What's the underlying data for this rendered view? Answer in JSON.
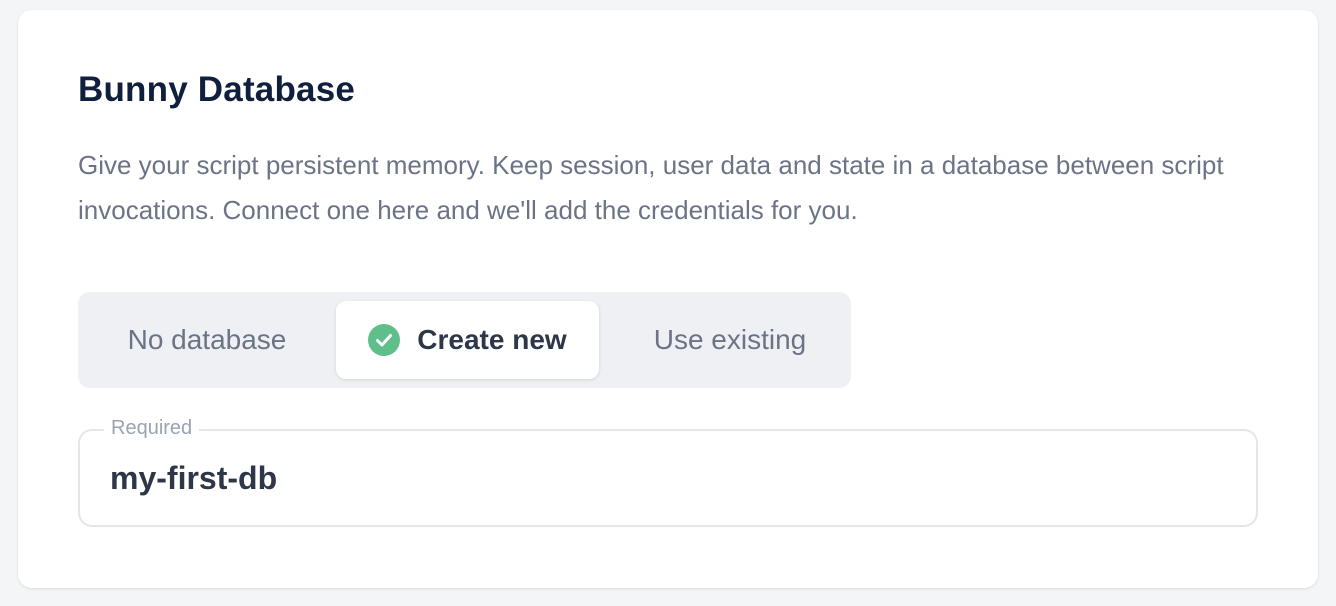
{
  "card": {
    "title": "Bunny Database",
    "description": "Give your script persistent memory. Keep session, user data and state in a database between script invocations. Connect one here and we'll add the credentials for you."
  },
  "database_mode": {
    "options": [
      {
        "label": "No database",
        "selected": false
      },
      {
        "label": "Create new",
        "selected": true,
        "icon": "check-circle-icon"
      },
      {
        "label": "Use existing",
        "selected": false
      }
    ]
  },
  "name_field": {
    "label": "Required",
    "value": "my-first-db"
  },
  "colors": {
    "accent_check": "#5fbf8a",
    "title": "#0f1f3d",
    "muted_text": "#6b7486"
  }
}
